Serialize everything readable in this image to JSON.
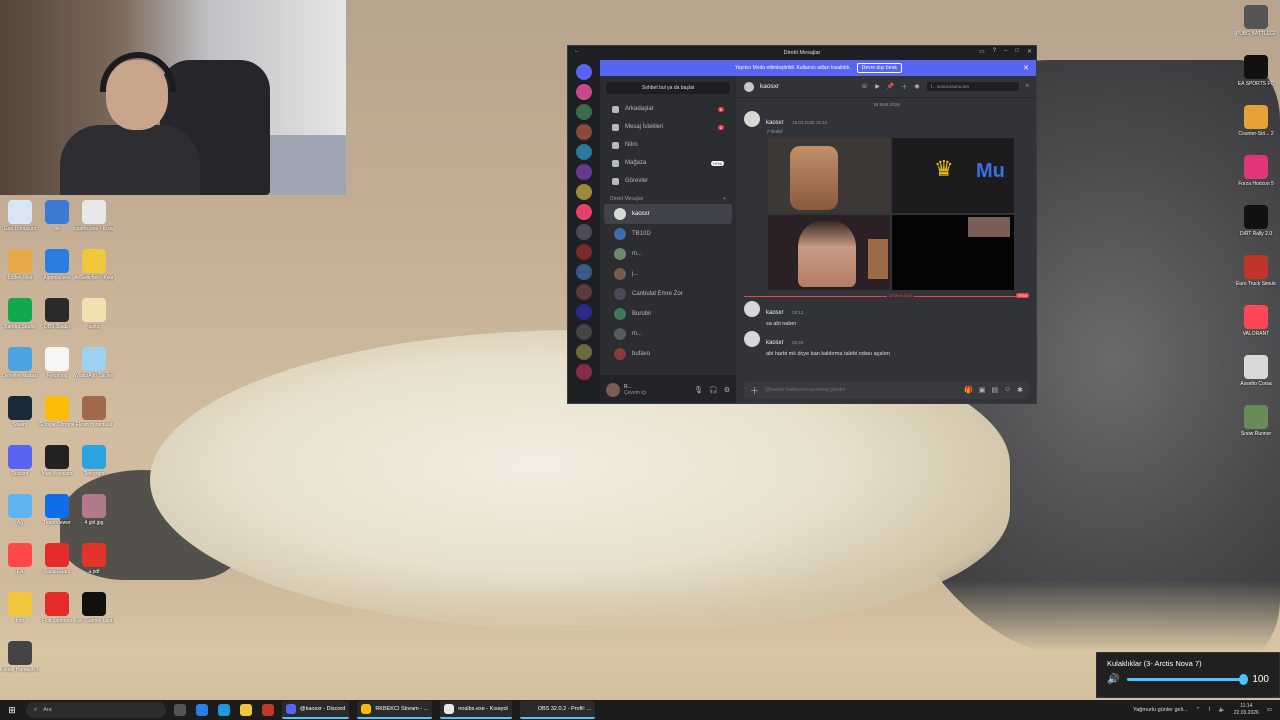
{
  "discord": {
    "window_title": "Direkt Mesajlar",
    "banner_text": "Yayıncı Modu etkinleştirildi. Kullanıcı adları kısaltıldı.",
    "banner_button": "Devre dışı bırak",
    "dm_search": "Sohbet bul ya da başlat",
    "nav": [
      {
        "label": "Arkadaşlar",
        "badge": "6"
      },
      {
        "label": "Mesaj İstekleri",
        "badge": "3"
      },
      {
        "label": "Nitro",
        "badge": ""
      },
      {
        "label": "Mağaza",
        "badge": "YENİ"
      },
      {
        "label": "Görevler",
        "badge": ""
      }
    ],
    "dm_header": "Direkt Mesajlar",
    "dms": [
      "kaosxr",
      "TB10D",
      "m...",
      "j...",
      "Canbulat Emre Zor",
      "Burobir",
      "m...",
      "bufavo"
    ],
    "user": {
      "name": "R...",
      "status": "Çevrim içi"
    },
    "chat_user": "kaosxr",
    "chat_search": "f... sunucusunu ara",
    "date1": "19 Mart 2026",
    "messages": [
      {
        "name": "kaosxr",
        "time": "19.03.2026 15:42",
        "text": "İletildi"
      },
      {
        "name": "kaosxr",
        "time": "02:13",
        "text": "sa abi naber"
      },
      {
        "name": "kaosxr",
        "time": "02:23",
        "text": "abi harbi mk dcye ban kaldırma talebi odası açalım"
      }
    ],
    "date2": "22 Mart 2026",
    "new_label": "YENİ",
    "composer_placeholder": "@kaosxr kullanıcısına mesaj gönder",
    "media_text": "Mu"
  },
  "desktop_icons_left": [
    [
      "Geri Dönüşüm",
      "#d9e6f2"
    ],
    [
      "bk",
      "#3b7bd6"
    ],
    [
      "noalbs.exe - Kısayol",
      "#e8e8e8"
    ],
    [
      "Lütfen Mini",
      "#e4a84b"
    ],
    [
      "Alpemix.exe",
      "#2b7de1"
    ],
    [
      "AltSwitcher - Kısayol",
      "#f0c63a"
    ],
    [
      "Bambu Studio",
      "#11a84e"
    ],
    [
      "OBS Studio",
      "#2a2a2a"
    ],
    [
      "astto",
      "#f0e0b0"
    ],
    [
      "Denetim Masası",
      "#4aa3df"
    ],
    [
      "Fotoshop",
      "#f5f5f5"
    ],
    [
      "WhatsApp Sticker...",
      "#9bd2f2"
    ],
    [
      "Steam",
      "#1b2838"
    ],
    [
      "Google Chrome",
      "#fbbc05"
    ],
    [
      "Ekran görüntüsü",
      "#a06b4a"
    ],
    [
      "Discord",
      "#5865f2"
    ],
    [
      "Iriun Webcam",
      "#222222"
    ],
    [
      "Telegram",
      "#2aa3e0"
    ],
    [
      "Ağ",
      "#5fb3f0"
    ],
    [
      "TeamViewer",
      "#0e6eea"
    ],
    [
      "4 girl.jpg",
      "#b07a8a"
    ],
    [
      "EA",
      "#ff4747"
    ],
    [
      "RadioGuard",
      "#e52a2a"
    ],
    [
      "a.pdf",
      "#e2342a"
    ],
    [
      "foto",
      "#f0c63a"
    ],
    [
      "Flott Jammen",
      "#e52a2a"
    ],
    [
      "Epic Games Launcher",
      "#111111"
    ],
    [
      "Kreatif Hareketli N...",
      "#444444"
    ]
  ],
  "desktop_icons_right": [
    [
      "PUBG BATTLEGR...",
      "#555555"
    ],
    [
      "EA SPORTS FC",
      "#111111"
    ],
    [
      "Counter-Stri... 2",
      "#e5a23a"
    ],
    [
      "Forza Horizon 5",
      "#e2347a"
    ],
    [
      "DiRT Rally 2.0",
      "#111111"
    ],
    [
      "Euro Truck Simulator 2",
      "#c2342a"
    ],
    [
      "VALORANT",
      "#ff4655"
    ],
    [
      "Assetto Corsa",
      "#d9d9d9"
    ],
    [
      "Snow Runner",
      "#6a8a5a"
    ]
  ],
  "volume": {
    "title": "Kulaklıklar (3- Arctis Nova 7)",
    "value": "100",
    "level": 1.0
  },
  "taskbar": {
    "search": "Ara",
    "apps": [
      {
        "label": "@kaosxr - Discord",
        "color": "#5865f2"
      },
      {
        "label": "RKBEKCI Stream - ...",
        "color": "#fbbc05"
      },
      {
        "label": "noalbs.exe - Kısayol",
        "color": "#e8e8e8"
      },
      {
        "label": "OBS 32.0.2 - Profil: ...",
        "color": "#2a2a2a"
      }
    ],
    "weather": "Yağmurlu günler geli...",
    "time": "11:14",
    "date": "22.03.2026"
  }
}
